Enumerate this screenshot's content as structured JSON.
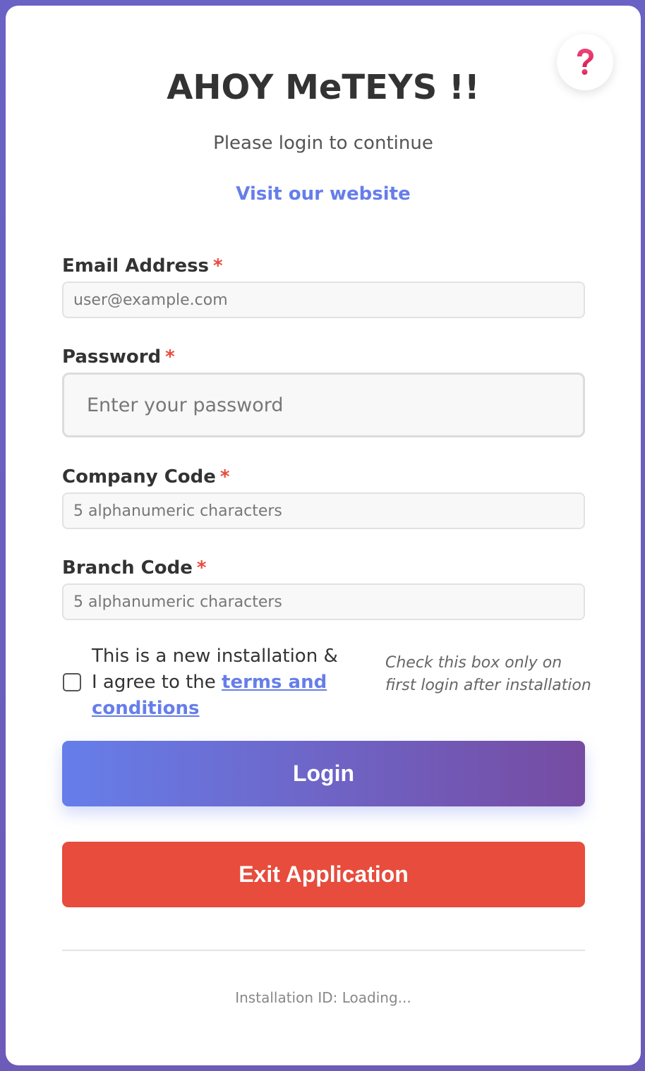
{
  "header": {
    "title": "AHOY MeTEYS !!",
    "subtitle": "Please login to continue",
    "website_link": "Visit our website",
    "help_icon": "question-mark-icon"
  },
  "form": {
    "email": {
      "label": "Email Address",
      "required_mark": "*",
      "placeholder": "user@example.com",
      "value": ""
    },
    "password": {
      "label": "Password",
      "required_mark": "*",
      "placeholder": "Enter your password",
      "value": ""
    },
    "company_code": {
      "label": "Company Code",
      "required_mark": "*",
      "placeholder": "5 alphanumeric characters",
      "value": ""
    },
    "branch_code": {
      "label": "Branch Code",
      "required_mark": "*",
      "placeholder": "5 alphanumeric characters",
      "value": ""
    },
    "new_install": {
      "checked": false,
      "text": "This is a new installation & I agree to the",
      "link_text": "terms and conditions",
      "hint": "Check this box only on first login after installation"
    }
  },
  "buttons": {
    "login_label": "Login",
    "exit_label": "Exit Application"
  },
  "footer": {
    "installation_id": "Installation ID: Loading..."
  },
  "colors": {
    "accent": "#667eea",
    "gradient_end": "#764ba2",
    "danger": "#e74c3c",
    "help_icon": "#e8336a"
  }
}
